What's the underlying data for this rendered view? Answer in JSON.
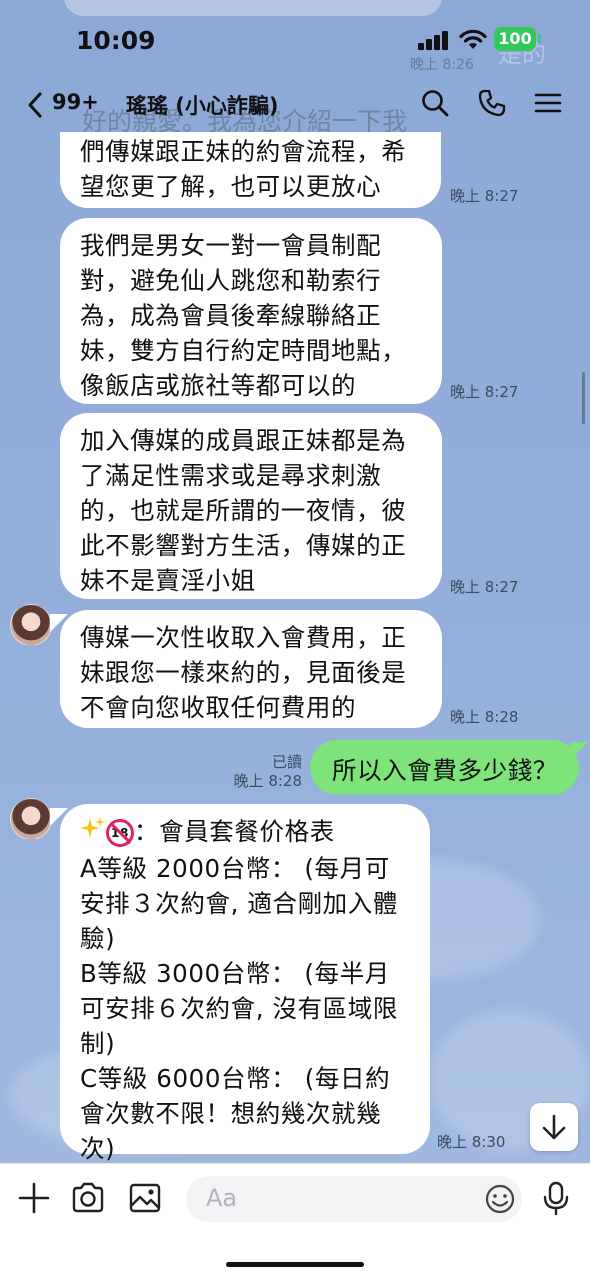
{
  "status_bar": {
    "time": "10:09",
    "battery": "100"
  },
  "header": {
    "unread_count": "99+",
    "title": "瑤瑤 (小心詐騙)",
    "ghost_text": "好的親愛。我為您介紹一下我",
    "ghost_right": "是的",
    "ghost_time": "晚上 8:26"
  },
  "messages": [
    {
      "lines": [
        "們傳媒跟正妹的約會流程，希",
        "望您更了解，也可以更放心"
      ],
      "time": "晚上 8:27"
    },
    {
      "lines": [
        "我們是男女一對一會員制配",
        "對，避免仙人跳您和勒索行",
        "為，成為會員後牽線聯絡正",
        "妹，雙方自行約定時間地點，",
        "像飯店或旅社等都可以的"
      ],
      "time": "晚上 8:27"
    },
    {
      "lines": [
        "加入傳媒的成員跟正妹都是為",
        "了滿足性需求或是尋求刺激",
        "的，也就是所謂的一夜情，彼",
        "此不影響對方生活，傳媒的正",
        "妹不是賣淫小姐"
      ],
      "time": "晚上 8:27"
    },
    {
      "lines": [
        "傳媒一次性收取入會費用，正",
        "妹跟您一樣來約的，見面後是",
        "不會向您收取任何費用的"
      ],
      "time": "晚上 8:28"
    }
  ],
  "my_message": {
    "text": "所以入會費多少錢？",
    "read_label": "已讀",
    "time": "晚上 8:28"
  },
  "price_message": {
    "title": "：會員套餐价格表",
    "lines": [
      "A等級 2000台幣： (每月可",
      "安排３次約會, 適合剛加入體",
      "驗)",
      "B等級 3000台幣： (每半月",
      "可安排６次約會, 沒有區域限",
      "制)",
      "C等級 6000台幣： (每日約",
      "會次數不限！想約幾次就幾",
      "次)"
    ],
    "time": "晚上 8:30"
  },
  "input": {
    "placeholder": "Aa"
  },
  "icons": [
    "back-icon",
    "search-icon",
    "phone-icon",
    "menu-icon",
    "plus-icon",
    "camera-icon",
    "image-icon",
    "emoji-icon",
    "mic-icon",
    "arrow-down-icon",
    "sparkles-icon",
    "no-under-18-icon"
  ]
}
